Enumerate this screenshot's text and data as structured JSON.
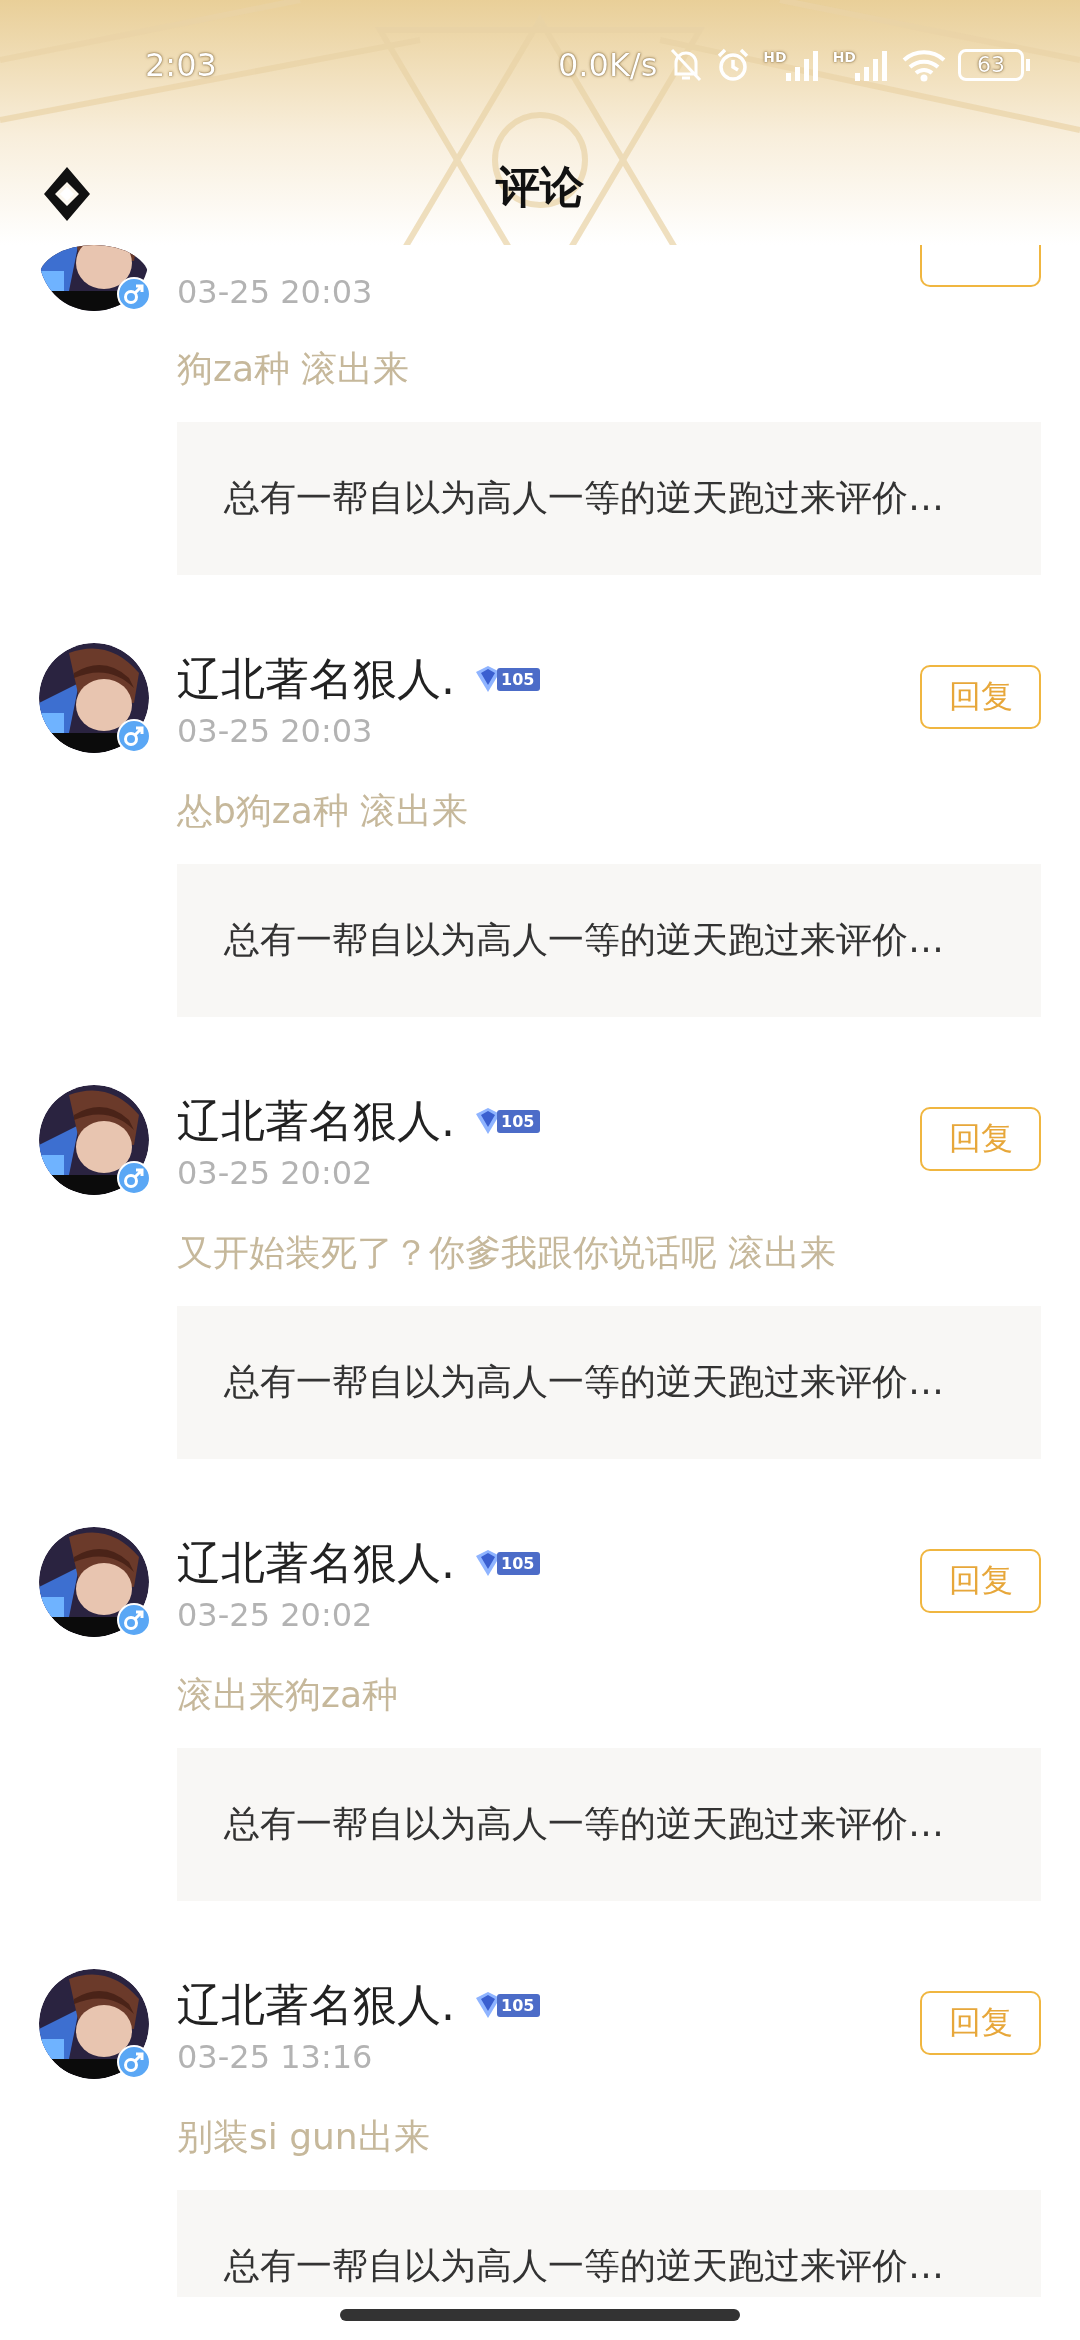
{
  "status_bar": {
    "time": "2:03",
    "speed": "0.0K/s",
    "signals": [
      {
        "label": "HD"
      },
      {
        "label": "HD"
      }
    ],
    "battery": "63"
  },
  "header": {
    "title": "评论"
  },
  "comments": [
    {
      "date": "03-25 20:03",
      "text": "狗za种 滚出来",
      "quote": "总有一帮自以为高人一等的逆天跑过来评价…"
    },
    {
      "name": "辽北著名狠人.",
      "level": "105",
      "date": "03-25 20:03",
      "text": "怂b狗za种 滚出来",
      "quote": "总有一帮自以为高人一等的逆天跑过来评价…",
      "reply": "回复"
    },
    {
      "name": "辽北著名狠人.",
      "level": "105",
      "date": "03-25 20:02",
      "text": "又开始装死了？你爹我跟你说话呢 滚出来",
      "quote": "总有一帮自以为高人一等的逆天跑过来评价…",
      "reply": "回复"
    },
    {
      "name": "辽北著名狠人.",
      "level": "105",
      "date": "03-25 20:02",
      "text": "滚出来狗za种",
      "quote": "总有一帮自以为高人一等的逆天跑过来评价…",
      "reply": "回复"
    },
    {
      "name": "辽北著名狠人.",
      "level": "105",
      "date": "03-25 13:16",
      "text": "别装si gun出来",
      "quote": "总有一帮自以为高人一等的逆天跑过来评价…",
      "reply": "回复"
    }
  ]
}
